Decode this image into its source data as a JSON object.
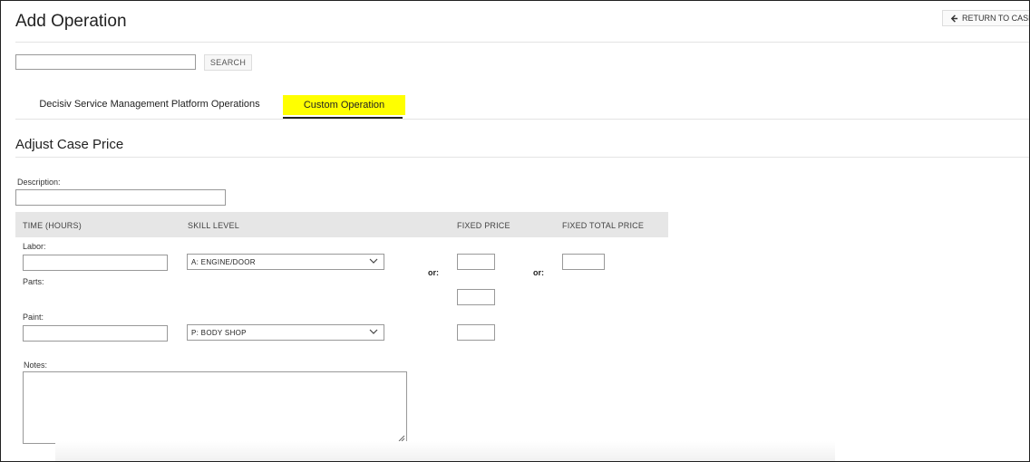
{
  "page": {
    "title": "Add Operation"
  },
  "header": {
    "return_label": "RETURN TO CASE"
  },
  "search": {
    "value": "",
    "button_label": "SEARCH"
  },
  "tabs": [
    {
      "label": "Decisiv Service Management Platform Operations",
      "active": false
    },
    {
      "label": "Custom Operation",
      "active": true
    }
  ],
  "section": {
    "title": "Adjust Case Price"
  },
  "form": {
    "description_label": "Description:",
    "description_value": "",
    "columns": {
      "time": "TIME (HOURS)",
      "skill": "SKILL LEVEL",
      "fixed_price": "FIXED PRICE",
      "fixed_total": "FIXED TOTAL PRICE"
    },
    "labor_label": "Labor:",
    "labor_skill": "A: ENGINE/DOOR",
    "parts_label": "Parts:",
    "paint_label": "Paint:",
    "paint_skill": "P: BODY SHOP",
    "or_label_1": "or:",
    "or_label_2": "or:",
    "notes_label": "Notes:",
    "notes_value": ""
  },
  "icons": {
    "return": "arrow-left-icon",
    "select": "chevron-down-icon",
    "resize": "resize-handle-icon"
  },
  "colors": {
    "active_tab": "#ffff00",
    "table_header": "#e6e6e6"
  }
}
